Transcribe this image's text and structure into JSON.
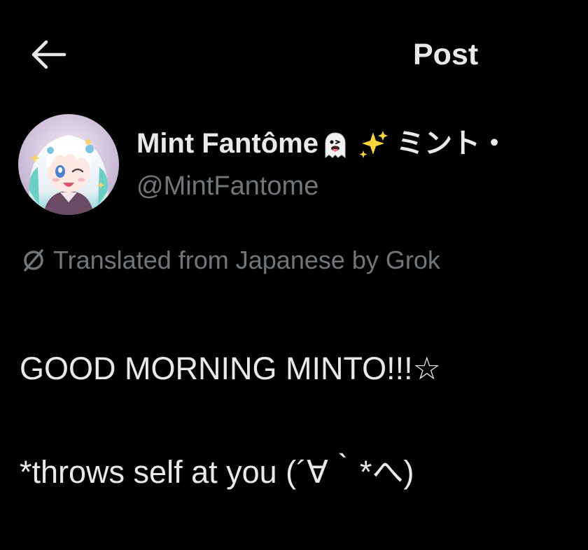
{
  "header": {
    "title": "Post"
  },
  "author": {
    "display_name": "Mint Fantôme",
    "display_name_suffix": "ミント・",
    "handle": "@MintFantome",
    "name_emojis": [
      "ghost-tongue-emoji",
      "sparkles-emoji"
    ]
  },
  "translation": {
    "label": "Translated from Japanese by Grok"
  },
  "post": {
    "line1": "GOOD MORNING MINTO!!!☆",
    "line2": "*throws self at you (´∀｀*へ)"
  },
  "colors": {
    "background": "#000000",
    "primary_text": "#e7e9ea",
    "secondary_text": "#71767b"
  }
}
